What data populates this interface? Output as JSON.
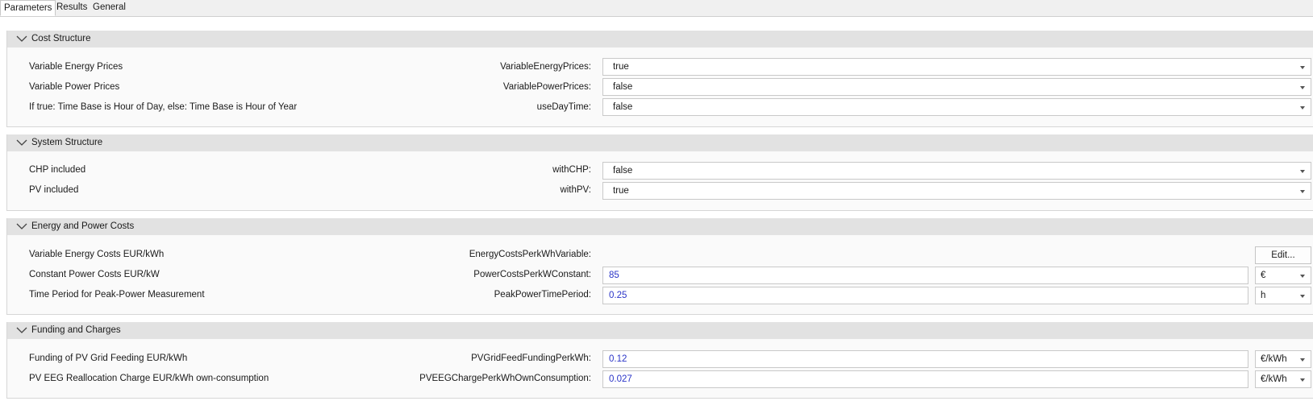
{
  "tabs": [
    "Parameters",
    "Results",
    "General"
  ],
  "groups": [
    {
      "title": "Cost Structure",
      "rows": [
        {
          "label": "Variable Energy Prices",
          "name": "VariableEnergyPrices:",
          "value": "true"
        },
        {
          "label": "Variable Power Prices",
          "name": "VariablePowerPrices:",
          "value": "false"
        },
        {
          "label": "If true: Time Base is Hour of Day, else: Time Base is Hour of Year",
          "name": "useDayTime:",
          "value": "false"
        }
      ]
    },
    {
      "title": "System Structure",
      "rows": [
        {
          "label": "CHP included",
          "name": "withCHP:",
          "value": "false"
        },
        {
          "label": "PV included",
          "name": "withPV:",
          "value": "true"
        }
      ]
    },
    {
      "title": "Energy and Power Costs",
      "rows": [
        {
          "label": "Variable Energy Costs EUR/kWh",
          "name": "EnergyCostsPerkWhVariable:",
          "button": "Edit..."
        },
        {
          "label": "Constant Power Costs EUR/kW",
          "name": "PowerCostsPerkWConstant:",
          "value": "85",
          "unit": "€"
        },
        {
          "label": "Time Period for Peak-Power Measurement",
          "name": "PeakPowerTimePeriod:",
          "value": "0.25",
          "unit": "h"
        }
      ]
    },
    {
      "title": "Funding and Charges",
      "rows": [
        {
          "label": "Funding of PV Grid Feeding EUR/kWh",
          "name": "PVGridFeedFundingPerkWh:",
          "value": "0.12",
          "unit": "€/kWh"
        },
        {
          "label": "PV EEG Reallocation Charge EUR/kWh own-consumption",
          "name": "PVEEGChargePerkWhOwnConsumption:",
          "value": "0.027",
          "unit": "€/kWh"
        }
      ]
    }
  ]
}
